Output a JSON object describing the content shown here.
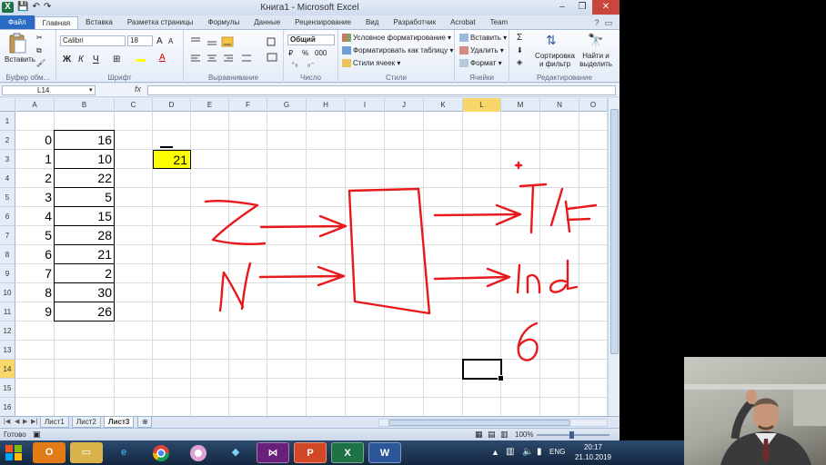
{
  "window": {
    "title": "Книга1 - Microsoft Excel",
    "minimize": "–",
    "restore": "❐",
    "close": "✕"
  },
  "qat": {
    "save": "💾",
    "undo": "↶",
    "redo": "↷"
  },
  "tabs": {
    "file": "Файл",
    "items": [
      "Главная",
      "Вставка",
      "Разметка страницы",
      "Формулы",
      "Данные",
      "Рецензирование",
      "Вид",
      "Разработчик",
      "Acrobat",
      "Team"
    ]
  },
  "ribbon": {
    "clipboard": {
      "paste": "Вставить",
      "label": "Буфер обм..."
    },
    "font": {
      "name": "Calibri",
      "size": "18",
      "bold": "Ж",
      "italic": "К",
      "underline": "Ч",
      "grow": "A",
      "shrink": "A",
      "label": "Шрифт"
    },
    "alignment": {
      "label": "Выравнивание"
    },
    "number": {
      "format": "Общий",
      "percent": "%",
      "thousands": "000",
      "label": "Число"
    },
    "styles": {
      "conditional": "Условное форматирование",
      "as_table": "Форматировать как таблицу",
      "cell_styles": "Стили ячеек",
      "label": "Стили"
    },
    "cells": {
      "insert": "Вставить",
      "delete": "Удалить",
      "format": "Формат",
      "label": "Ячейки"
    },
    "editing": {
      "sum": "Σ",
      "sort": "Сортировка и фильтр",
      "find": "Найти и выделить",
      "label": "Редактирование"
    }
  },
  "formula_bar": {
    "name_box": "L14",
    "fx": "fx",
    "content": ""
  },
  "columns": [
    "A",
    "B",
    "C",
    "D",
    "E",
    "F",
    "G",
    "H",
    "I",
    "J",
    "K",
    "L",
    "M",
    "N",
    "O"
  ],
  "rows": [
    "1",
    "2",
    "3",
    "4",
    "5",
    "6",
    "7",
    "8",
    "9",
    "10",
    "11",
    "12",
    "13",
    "14",
    "15",
    "16"
  ],
  "selected": {
    "column": "L",
    "row": "14"
  },
  "cells": {
    "col_a": [
      "0",
      "1",
      "2",
      "3",
      "4",
      "5",
      "6",
      "7",
      "8",
      "9"
    ],
    "col_b": [
      "16",
      "10",
      "22",
      "5",
      "15",
      "28",
      "21",
      "2",
      "30",
      "26"
    ],
    "d3": "21"
  },
  "highlight_color": "#ffff00",
  "ink_color": "#e8191d",
  "sheets": [
    "Лист1",
    "Лист2",
    "Лист3"
  ],
  "active_sheet": "Лист3",
  "status": {
    "ready": "Готово",
    "zoom": "100%"
  },
  "taskbar": {
    "apps": [
      "outlook-icon",
      "explorer-icon",
      "ie-icon",
      "chrome-icon",
      "picasa-icon",
      "app-icon",
      "visual-studio-icon",
      "powerpoint-icon",
      "excel-icon",
      "word-icon"
    ],
    "lang": "ENG",
    "time": "20:17",
    "date": "21.10.2019"
  }
}
